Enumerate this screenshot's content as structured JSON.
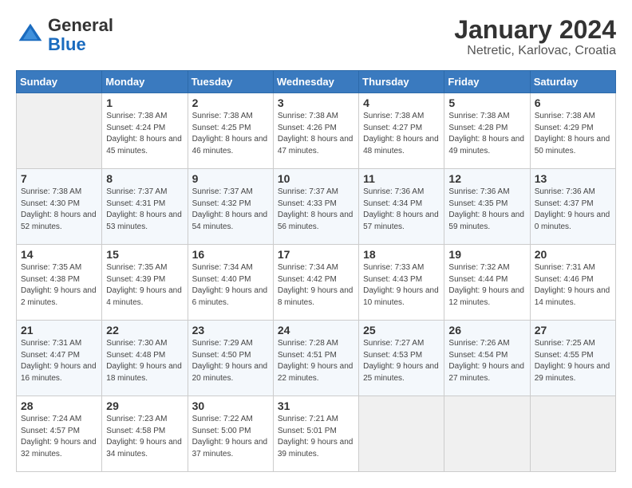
{
  "header": {
    "logo_general": "General",
    "logo_blue": "Blue",
    "month_title": "January 2024",
    "location": "Netretic, Karlovac, Croatia"
  },
  "days_of_week": [
    "Sunday",
    "Monday",
    "Tuesday",
    "Wednesday",
    "Thursday",
    "Friday",
    "Saturday"
  ],
  "weeks": [
    [
      {
        "day": "",
        "sunrise": "",
        "sunset": "",
        "daylight": ""
      },
      {
        "day": "1",
        "sunrise": "Sunrise: 7:38 AM",
        "sunset": "Sunset: 4:24 PM",
        "daylight": "Daylight: 8 hours and 45 minutes."
      },
      {
        "day": "2",
        "sunrise": "Sunrise: 7:38 AM",
        "sunset": "Sunset: 4:25 PM",
        "daylight": "Daylight: 8 hours and 46 minutes."
      },
      {
        "day": "3",
        "sunrise": "Sunrise: 7:38 AM",
        "sunset": "Sunset: 4:26 PM",
        "daylight": "Daylight: 8 hours and 47 minutes."
      },
      {
        "day": "4",
        "sunrise": "Sunrise: 7:38 AM",
        "sunset": "Sunset: 4:27 PM",
        "daylight": "Daylight: 8 hours and 48 minutes."
      },
      {
        "day": "5",
        "sunrise": "Sunrise: 7:38 AM",
        "sunset": "Sunset: 4:28 PM",
        "daylight": "Daylight: 8 hours and 49 minutes."
      },
      {
        "day": "6",
        "sunrise": "Sunrise: 7:38 AM",
        "sunset": "Sunset: 4:29 PM",
        "daylight": "Daylight: 8 hours and 50 minutes."
      }
    ],
    [
      {
        "day": "7",
        "sunrise": "Sunrise: 7:38 AM",
        "sunset": "Sunset: 4:30 PM",
        "daylight": "Daylight: 8 hours and 52 minutes."
      },
      {
        "day": "8",
        "sunrise": "Sunrise: 7:37 AM",
        "sunset": "Sunset: 4:31 PM",
        "daylight": "Daylight: 8 hours and 53 minutes."
      },
      {
        "day": "9",
        "sunrise": "Sunrise: 7:37 AM",
        "sunset": "Sunset: 4:32 PM",
        "daylight": "Daylight: 8 hours and 54 minutes."
      },
      {
        "day": "10",
        "sunrise": "Sunrise: 7:37 AM",
        "sunset": "Sunset: 4:33 PM",
        "daylight": "Daylight: 8 hours and 56 minutes."
      },
      {
        "day": "11",
        "sunrise": "Sunrise: 7:36 AM",
        "sunset": "Sunset: 4:34 PM",
        "daylight": "Daylight: 8 hours and 57 minutes."
      },
      {
        "day": "12",
        "sunrise": "Sunrise: 7:36 AM",
        "sunset": "Sunset: 4:35 PM",
        "daylight": "Daylight: 8 hours and 59 minutes."
      },
      {
        "day": "13",
        "sunrise": "Sunrise: 7:36 AM",
        "sunset": "Sunset: 4:37 PM",
        "daylight": "Daylight: 9 hours and 0 minutes."
      }
    ],
    [
      {
        "day": "14",
        "sunrise": "Sunrise: 7:35 AM",
        "sunset": "Sunset: 4:38 PM",
        "daylight": "Daylight: 9 hours and 2 minutes."
      },
      {
        "day": "15",
        "sunrise": "Sunrise: 7:35 AM",
        "sunset": "Sunset: 4:39 PM",
        "daylight": "Daylight: 9 hours and 4 minutes."
      },
      {
        "day": "16",
        "sunrise": "Sunrise: 7:34 AM",
        "sunset": "Sunset: 4:40 PM",
        "daylight": "Daylight: 9 hours and 6 minutes."
      },
      {
        "day": "17",
        "sunrise": "Sunrise: 7:34 AM",
        "sunset": "Sunset: 4:42 PM",
        "daylight": "Daylight: 9 hours and 8 minutes."
      },
      {
        "day": "18",
        "sunrise": "Sunrise: 7:33 AM",
        "sunset": "Sunset: 4:43 PM",
        "daylight": "Daylight: 9 hours and 10 minutes."
      },
      {
        "day": "19",
        "sunrise": "Sunrise: 7:32 AM",
        "sunset": "Sunset: 4:44 PM",
        "daylight": "Daylight: 9 hours and 12 minutes."
      },
      {
        "day": "20",
        "sunrise": "Sunrise: 7:31 AM",
        "sunset": "Sunset: 4:46 PM",
        "daylight": "Daylight: 9 hours and 14 minutes."
      }
    ],
    [
      {
        "day": "21",
        "sunrise": "Sunrise: 7:31 AM",
        "sunset": "Sunset: 4:47 PM",
        "daylight": "Daylight: 9 hours and 16 minutes."
      },
      {
        "day": "22",
        "sunrise": "Sunrise: 7:30 AM",
        "sunset": "Sunset: 4:48 PM",
        "daylight": "Daylight: 9 hours and 18 minutes."
      },
      {
        "day": "23",
        "sunrise": "Sunrise: 7:29 AM",
        "sunset": "Sunset: 4:50 PM",
        "daylight": "Daylight: 9 hours and 20 minutes."
      },
      {
        "day": "24",
        "sunrise": "Sunrise: 7:28 AM",
        "sunset": "Sunset: 4:51 PM",
        "daylight": "Daylight: 9 hours and 22 minutes."
      },
      {
        "day": "25",
        "sunrise": "Sunrise: 7:27 AM",
        "sunset": "Sunset: 4:53 PM",
        "daylight": "Daylight: 9 hours and 25 minutes."
      },
      {
        "day": "26",
        "sunrise": "Sunrise: 7:26 AM",
        "sunset": "Sunset: 4:54 PM",
        "daylight": "Daylight: 9 hours and 27 minutes."
      },
      {
        "day": "27",
        "sunrise": "Sunrise: 7:25 AM",
        "sunset": "Sunset: 4:55 PM",
        "daylight": "Daylight: 9 hours and 29 minutes."
      }
    ],
    [
      {
        "day": "28",
        "sunrise": "Sunrise: 7:24 AM",
        "sunset": "Sunset: 4:57 PM",
        "daylight": "Daylight: 9 hours and 32 minutes."
      },
      {
        "day": "29",
        "sunrise": "Sunrise: 7:23 AM",
        "sunset": "Sunset: 4:58 PM",
        "daylight": "Daylight: 9 hours and 34 minutes."
      },
      {
        "day": "30",
        "sunrise": "Sunrise: 7:22 AM",
        "sunset": "Sunset: 5:00 PM",
        "daylight": "Daylight: 9 hours and 37 minutes."
      },
      {
        "day": "31",
        "sunrise": "Sunrise: 7:21 AM",
        "sunset": "Sunset: 5:01 PM",
        "daylight": "Daylight: 9 hours and 39 minutes."
      },
      {
        "day": "",
        "sunrise": "",
        "sunset": "",
        "daylight": ""
      },
      {
        "day": "",
        "sunrise": "",
        "sunset": "",
        "daylight": ""
      },
      {
        "day": "",
        "sunrise": "",
        "sunset": "",
        "daylight": ""
      }
    ]
  ]
}
